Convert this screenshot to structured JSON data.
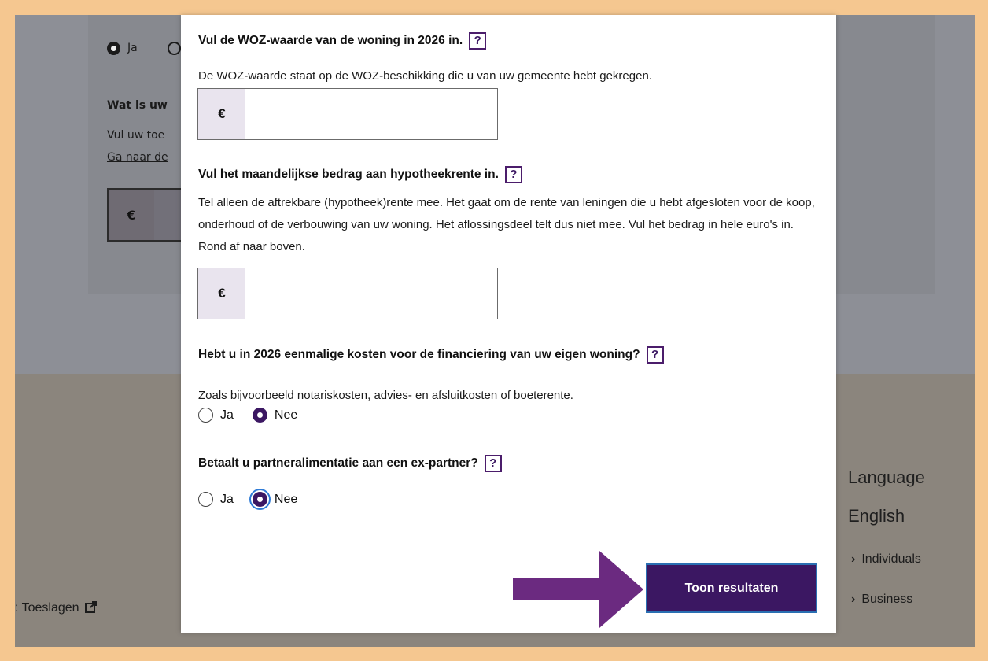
{
  "background": {
    "radio_label_ja": "Ja",
    "question_partial": "Wat is uw",
    "text_partial": "Vul uw toe",
    "link_partial": "Ga naar de",
    "currency": "€",
    "language_heading": "Language",
    "language_link": "English",
    "links": [
      "Individuals",
      "Business"
    ],
    "footer_link": ": Toeslagen"
  },
  "modal": {
    "woz": {
      "title": "Vul de WOZ-waarde van de woning in 2026 in.",
      "help": "?",
      "description": "De WOZ-waarde staat op de WOZ-beschikking die u van uw gemeente hebt gekregen.",
      "currency": "€",
      "value": ""
    },
    "interest": {
      "title": "Vul het maandelijkse bedrag aan hypotheekrente in.",
      "help": "?",
      "description": "Tel alleen de aftrekbare (hypotheek)rente mee. Het gaat om de rente van leningen die u hebt afgesloten voor de koop, onderhoud of de verbouwing van uw woning. Het aflossingsdeel telt dus niet mee. Vul het bedrag in hele euro's in. Rond af naar boven.",
      "currency": "€",
      "value": ""
    },
    "costs": {
      "title": "Hebt u in 2026 eenmalige kosten voor de financiering van uw eigen woning?",
      "help": "?",
      "description": "Zoals bijvoorbeeld notariskosten, advies- en afsluitkosten of boeterente.",
      "options": [
        "Ja",
        "Nee"
      ],
      "selected": "Nee"
    },
    "alimony": {
      "title": "Betaalt u partneralimentatie aan een ex-partner?",
      "help": "?",
      "options": [
        "Ja",
        "Nee"
      ],
      "selected": "Nee"
    },
    "submit_label": "Toon resultaten"
  },
  "colors": {
    "accent": "#3b1762",
    "arrow": "#6b2a80",
    "frame": "#f5c790"
  }
}
